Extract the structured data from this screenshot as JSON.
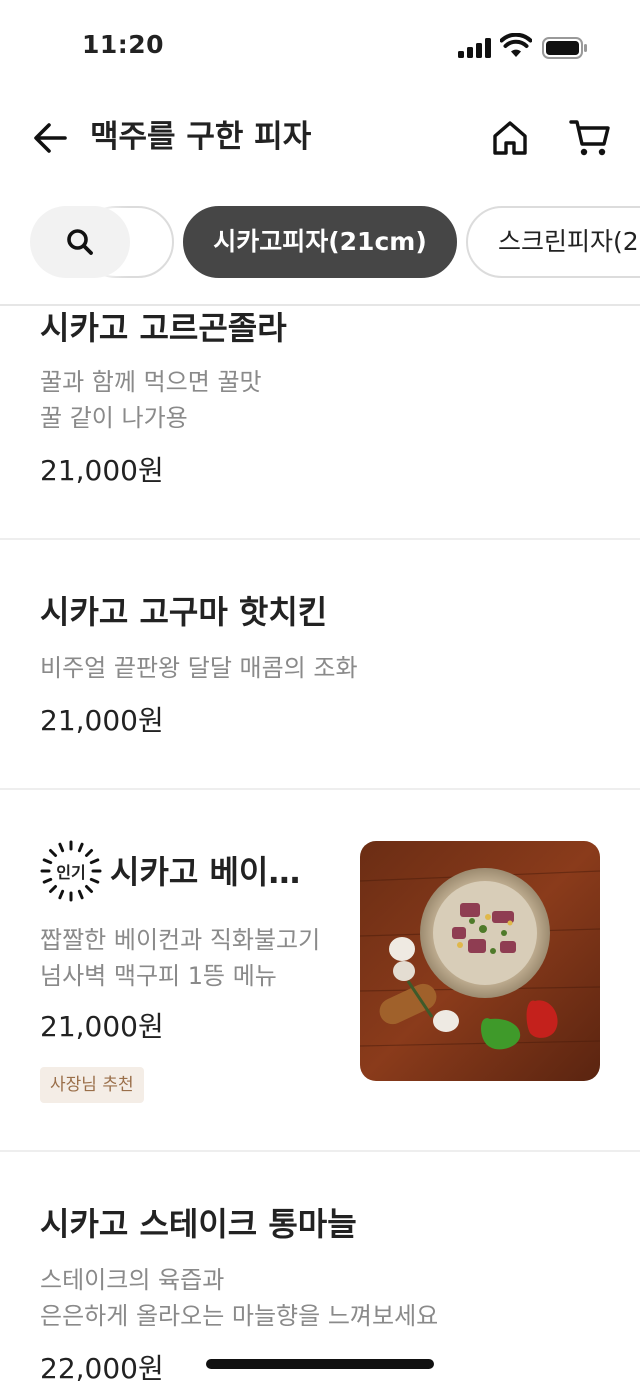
{
  "status_bar": {
    "time": "11:20"
  },
  "header": {
    "title": "맥주를 구한 피자",
    "back_icon": "arrow-left-icon",
    "home_icon": "home-icon",
    "cart_icon": "cart-icon"
  },
  "categories": {
    "search_icon": "search-icon",
    "tabs": [
      {
        "label": "시카고피자(21cm)",
        "active": true
      },
      {
        "label": "스크린피자(2",
        "active": false
      }
    ]
  },
  "menu_items": [
    {
      "name": "시카고 고르곤졸라",
      "description": [
        "꿀과 함께 먹으면 꿀맛",
        "꿀 같이 나가용"
      ],
      "price": "21,000원"
    },
    {
      "name": "시카고 고구마 핫치킨",
      "description": [
        "비주얼 끝판왕 달달 매콤의 조화"
      ],
      "price": "21,000원"
    },
    {
      "name": "시카고 베이…",
      "badge": "인기",
      "description": [
        "짭짤한 베이컨과 직화불고기",
        "넘사벽 맥구피 1뜽 메뉴"
      ],
      "price": "21,000원",
      "tag": "사장님 추천",
      "image": "pizza-photo"
    },
    {
      "name": "시카고 스테이크 통마늘",
      "description": [
        "스테이크의 육즙과",
        "은은하게 올라오는 마늘향을 느껴보세요"
      ],
      "price": "22,000원"
    }
  ],
  "colors": {
    "active_tab_bg": "#464646",
    "tag_bg": "#f4ede6",
    "tag_text": "#9a6f4a",
    "desc_text": "#8a8a8a"
  }
}
